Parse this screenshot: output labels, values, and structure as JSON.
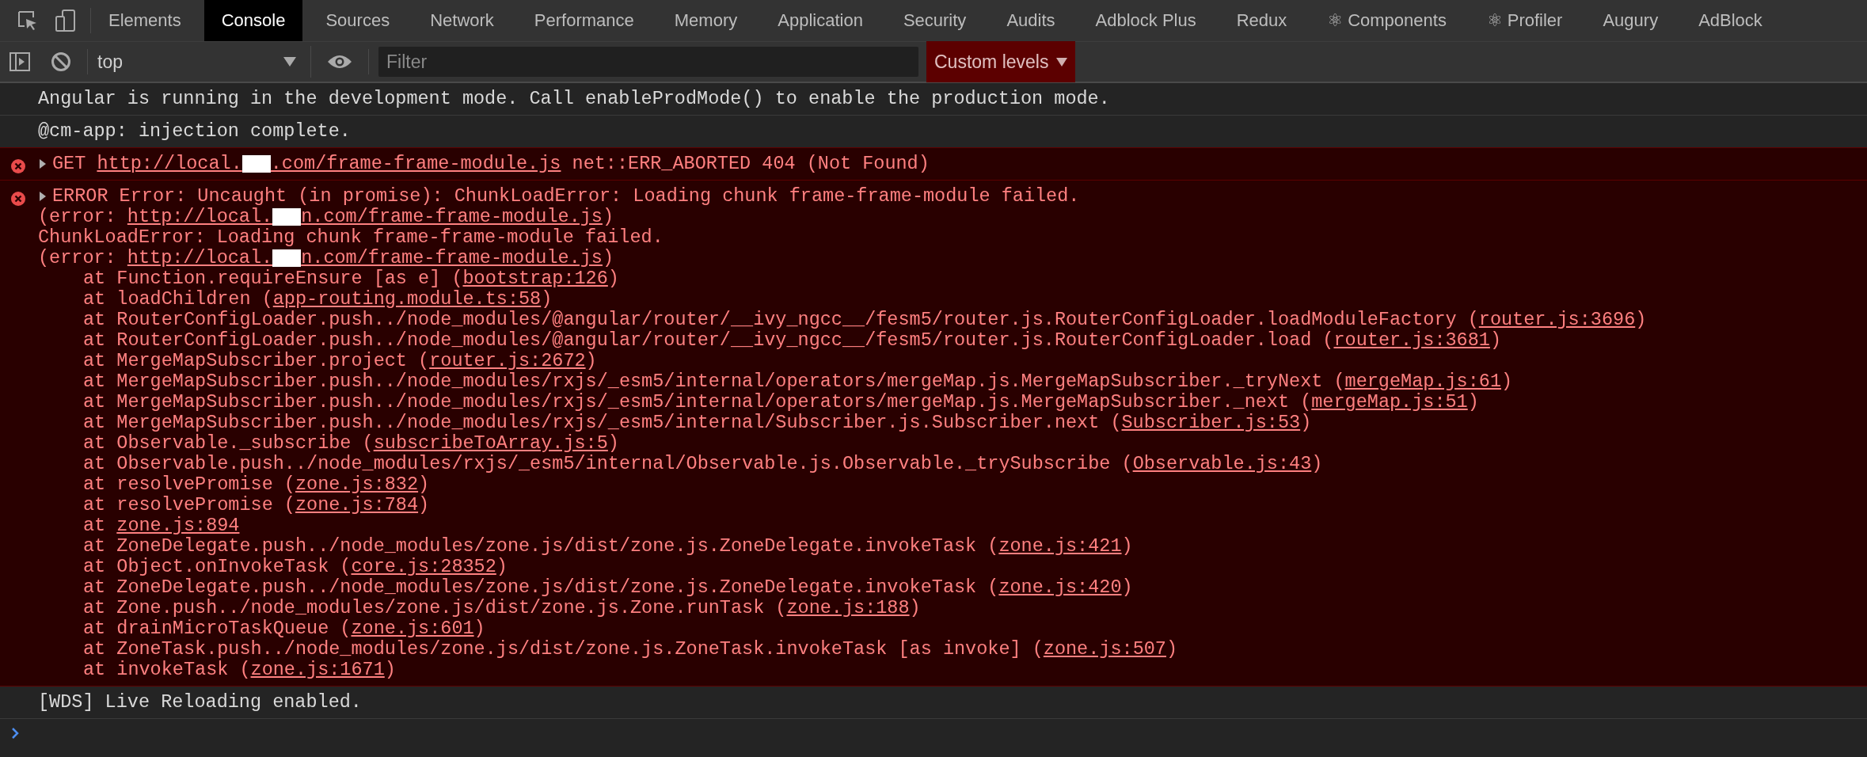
{
  "tabs": [
    {
      "label": "Elements",
      "selected": false
    },
    {
      "label": "Console",
      "selected": true
    },
    {
      "label": "Sources",
      "selected": false
    },
    {
      "label": "Network",
      "selected": false
    },
    {
      "label": "Performance",
      "selected": false
    },
    {
      "label": "Memory",
      "selected": false
    },
    {
      "label": "Application",
      "selected": false
    },
    {
      "label": "Security",
      "selected": false
    },
    {
      "label": "Audits",
      "selected": false
    },
    {
      "label": "Adblock Plus",
      "selected": false
    },
    {
      "label": "Redux",
      "selected": false
    },
    {
      "label": "⚛ Components",
      "selected": false
    },
    {
      "label": "⚛ Profiler",
      "selected": false
    },
    {
      "label": "Augury",
      "selected": false
    },
    {
      "label": "AdBlock",
      "selected": false
    }
  ],
  "toolbar": {
    "context": "top",
    "filter_placeholder": "Filter",
    "levels_button": "Custom levels"
  },
  "messages": [
    {
      "kind": "info",
      "lines": [
        {
          "kind": "text",
          "parts": [
            {
              "kind": "text",
              "text": "Angular is running in the development mode. Call enableProdMode() to enable the production mode."
            }
          ]
        }
      ]
    },
    {
      "kind": "info",
      "lines": [
        {
          "kind": "text",
          "parts": [
            {
              "kind": "text",
              "text": "@cm-app: injection complete."
            }
          ]
        }
      ]
    },
    {
      "kind": "error",
      "expanded": false,
      "lines": [
        {
          "kind": "text",
          "parts": [
            {
              "kind": "text",
              "text": "GET "
            },
            {
              "kind": "link",
              "text": "http://local."
            },
            {
              "kind": "redacted"
            },
            {
              "kind": "link",
              "text": ".com/frame-frame-module.js"
            },
            {
              "kind": "text",
              "text": " net::ERR_ABORTED 404 (Not Found)"
            }
          ]
        }
      ]
    },
    {
      "kind": "error",
      "expanded": false,
      "lines": [
        {
          "kind": "text",
          "parts": [
            {
              "kind": "text",
              "text": "ERROR Error: Uncaught (in promise): ChunkLoadError: Loading chunk frame-frame-module failed."
            }
          ]
        },
        {
          "kind": "text",
          "parts": [
            {
              "kind": "text",
              "text": "(error: "
            },
            {
              "kind": "link",
              "text": "http://local."
            },
            {
              "kind": "redacted"
            },
            {
              "kind": "link",
              "text": "n.com/frame-frame-module.js"
            },
            {
              "kind": "text",
              "text": ")"
            }
          ]
        },
        {
          "kind": "text",
          "parts": [
            {
              "kind": "text",
              "text": "ChunkLoadError: Loading chunk frame-frame-module failed."
            }
          ]
        },
        {
          "kind": "text",
          "parts": [
            {
              "kind": "text",
              "text": "(error: "
            },
            {
              "kind": "link",
              "text": "http://local."
            },
            {
              "kind": "redacted"
            },
            {
              "kind": "link",
              "text": "n.com/frame-frame-module.js"
            },
            {
              "kind": "text",
              "text": ")"
            }
          ]
        },
        {
          "kind": "frame",
          "parts": [
            {
              "kind": "text",
              "text": "at Function.requireEnsure [as e] ("
            },
            {
              "kind": "link",
              "text": "bootstrap:126"
            },
            {
              "kind": "text",
              "text": ")"
            }
          ]
        },
        {
          "kind": "frame",
          "parts": [
            {
              "kind": "text",
              "text": "at loadChildren ("
            },
            {
              "kind": "link",
              "text": "app-routing.module.ts:58"
            },
            {
              "kind": "text",
              "text": ")"
            }
          ]
        },
        {
          "kind": "frame",
          "parts": [
            {
              "kind": "text",
              "text": "at RouterConfigLoader.push../node_modules/@angular/router/__ivy_ngcc__/fesm5/router.js.RouterConfigLoader.loadModuleFactory ("
            },
            {
              "kind": "link",
              "text": "router.js:3696"
            },
            {
              "kind": "text",
              "text": ")"
            }
          ]
        },
        {
          "kind": "frame",
          "parts": [
            {
              "kind": "text",
              "text": "at RouterConfigLoader.push../node_modules/@angular/router/__ivy_ngcc__/fesm5/router.js.RouterConfigLoader.load ("
            },
            {
              "kind": "link",
              "text": "router.js:3681"
            },
            {
              "kind": "text",
              "text": ")"
            }
          ]
        },
        {
          "kind": "frame",
          "parts": [
            {
              "kind": "text",
              "text": "at MergeMapSubscriber.project ("
            },
            {
              "kind": "link",
              "text": "router.js:2672"
            },
            {
              "kind": "text",
              "text": ")"
            }
          ]
        },
        {
          "kind": "frame",
          "parts": [
            {
              "kind": "text",
              "text": "at MergeMapSubscriber.push../node_modules/rxjs/_esm5/internal/operators/mergeMap.js.MergeMapSubscriber._tryNext ("
            },
            {
              "kind": "link",
              "text": "mergeMap.js:61"
            },
            {
              "kind": "text",
              "text": ")"
            }
          ]
        },
        {
          "kind": "frame",
          "parts": [
            {
              "kind": "text",
              "text": "at MergeMapSubscriber.push../node_modules/rxjs/_esm5/internal/operators/mergeMap.js.MergeMapSubscriber._next ("
            },
            {
              "kind": "link",
              "text": "mergeMap.js:51"
            },
            {
              "kind": "text",
              "text": ")"
            }
          ]
        },
        {
          "kind": "frame",
          "parts": [
            {
              "kind": "text",
              "text": "at MergeMapSubscriber.push../node_modules/rxjs/_esm5/internal/Subscriber.js.Subscriber.next ("
            },
            {
              "kind": "link",
              "text": "Subscriber.js:53"
            },
            {
              "kind": "text",
              "text": ")"
            }
          ]
        },
        {
          "kind": "frame",
          "parts": [
            {
              "kind": "text",
              "text": "at Observable._subscribe ("
            },
            {
              "kind": "link",
              "text": "subscribeToArray.js:5"
            },
            {
              "kind": "text",
              "text": ")"
            }
          ]
        },
        {
          "kind": "frame",
          "parts": [
            {
              "kind": "text",
              "text": "at Observable.push../node_modules/rxjs/_esm5/internal/Observable.js.Observable._trySubscribe ("
            },
            {
              "kind": "link",
              "text": "Observable.js:43"
            },
            {
              "kind": "text",
              "text": ")"
            }
          ]
        },
        {
          "kind": "frame",
          "parts": [
            {
              "kind": "text",
              "text": "at resolvePromise ("
            },
            {
              "kind": "link",
              "text": "zone.js:832"
            },
            {
              "kind": "text",
              "text": ")"
            }
          ]
        },
        {
          "kind": "frame",
          "parts": [
            {
              "kind": "text",
              "text": "at resolvePromise ("
            },
            {
              "kind": "link",
              "text": "zone.js:784"
            },
            {
              "kind": "text",
              "text": ")"
            }
          ]
        },
        {
          "kind": "frame",
          "parts": [
            {
              "kind": "text",
              "text": "at "
            },
            {
              "kind": "link",
              "text": "zone.js:894"
            }
          ]
        },
        {
          "kind": "frame",
          "parts": [
            {
              "kind": "text",
              "text": "at ZoneDelegate.push../node_modules/zone.js/dist/zone.js.ZoneDelegate.invokeTask ("
            },
            {
              "kind": "link",
              "text": "zone.js:421"
            },
            {
              "kind": "text",
              "text": ")"
            }
          ]
        },
        {
          "kind": "frame",
          "parts": [
            {
              "kind": "text",
              "text": "at Object.onInvokeTask ("
            },
            {
              "kind": "link",
              "text": "core.js:28352"
            },
            {
              "kind": "text",
              "text": ")"
            }
          ]
        },
        {
          "kind": "frame",
          "parts": [
            {
              "kind": "text",
              "text": "at ZoneDelegate.push../node_modules/zone.js/dist/zone.js.ZoneDelegate.invokeTask ("
            },
            {
              "kind": "link",
              "text": "zone.js:420"
            },
            {
              "kind": "text",
              "text": ")"
            }
          ]
        },
        {
          "kind": "frame",
          "parts": [
            {
              "kind": "text",
              "text": "at Zone.push../node_modules/zone.js/dist/zone.js.Zone.runTask ("
            },
            {
              "kind": "link",
              "text": "zone.js:188"
            },
            {
              "kind": "text",
              "text": ")"
            }
          ]
        },
        {
          "kind": "frame",
          "parts": [
            {
              "kind": "text",
              "text": "at drainMicroTaskQueue ("
            },
            {
              "kind": "link",
              "text": "zone.js:601"
            },
            {
              "kind": "text",
              "text": ")"
            }
          ]
        },
        {
          "kind": "frame",
          "parts": [
            {
              "kind": "text",
              "text": "at ZoneTask.push../node_modules/zone.js/dist/zone.js.ZoneTask.invokeTask [as invoke] ("
            },
            {
              "kind": "link",
              "text": "zone.js:507"
            },
            {
              "kind": "text",
              "text": ")"
            }
          ]
        },
        {
          "kind": "frame",
          "parts": [
            {
              "kind": "text",
              "text": "at invokeTask ("
            },
            {
              "kind": "link",
              "text": "zone.js:1671"
            },
            {
              "kind": "text",
              "text": ")"
            }
          ]
        }
      ]
    },
    {
      "kind": "info",
      "lines": [
        {
          "kind": "text",
          "parts": [
            {
              "kind": "text",
              "text": "[WDS] Live Reloading enabled."
            }
          ]
        }
      ]
    }
  ]
}
